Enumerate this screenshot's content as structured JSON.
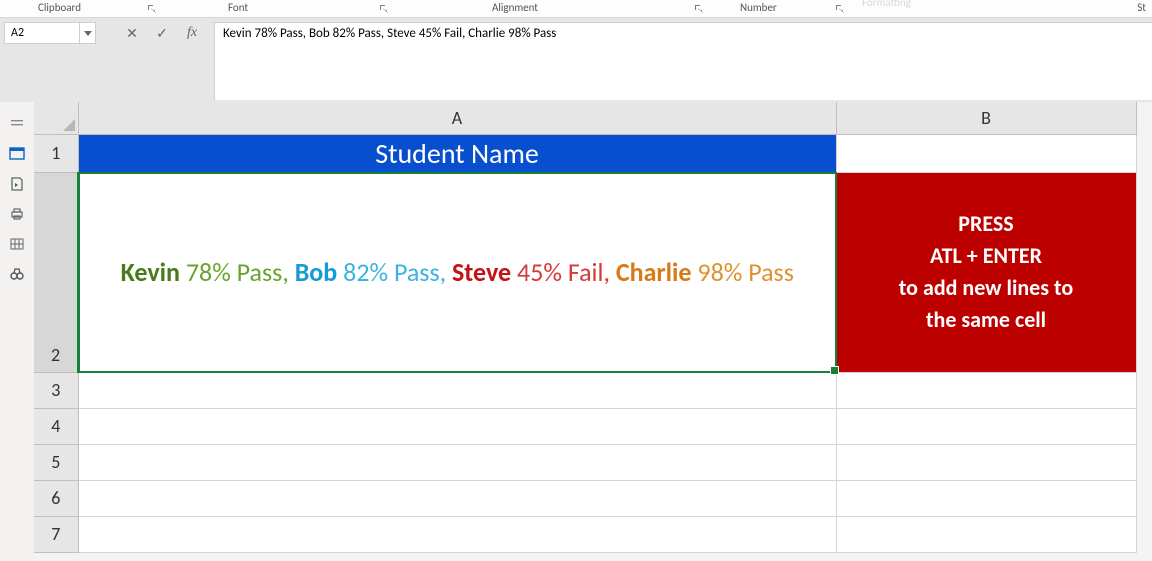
{
  "ribbon": {
    "clipboard": "Clipboard",
    "font": "Font",
    "alignment": "Alignment",
    "number": "Number",
    "formatting": "Formatting",
    "styles_suffix": "St"
  },
  "namebox": "A2",
  "formula": "Kevin 78% Pass, Bob 82% Pass, Steve 45% Fail, Charlie 98% Pass",
  "fx_label": "fx",
  "columns": {
    "A": "A",
    "B": "B"
  },
  "row_numbers": [
    "1",
    "2",
    "3",
    "4",
    "5",
    "6",
    "7"
  ],
  "header_cell": "Student Name",
  "segments": {
    "kevin": "Kevin",
    "kevin_pct": "78% Pass,",
    "bob": "Bob",
    "bob_pct": "82% Pass,",
    "steve": "Steve",
    "steve_pct": "45% Fail,",
    "charlie": "Charlie",
    "charlie_pct": "98% Pass"
  },
  "message": {
    "l1": "PRESS",
    "l2": "ATL + ENTER",
    "l3": "to add new lines to",
    "l4": "the same cell"
  }
}
